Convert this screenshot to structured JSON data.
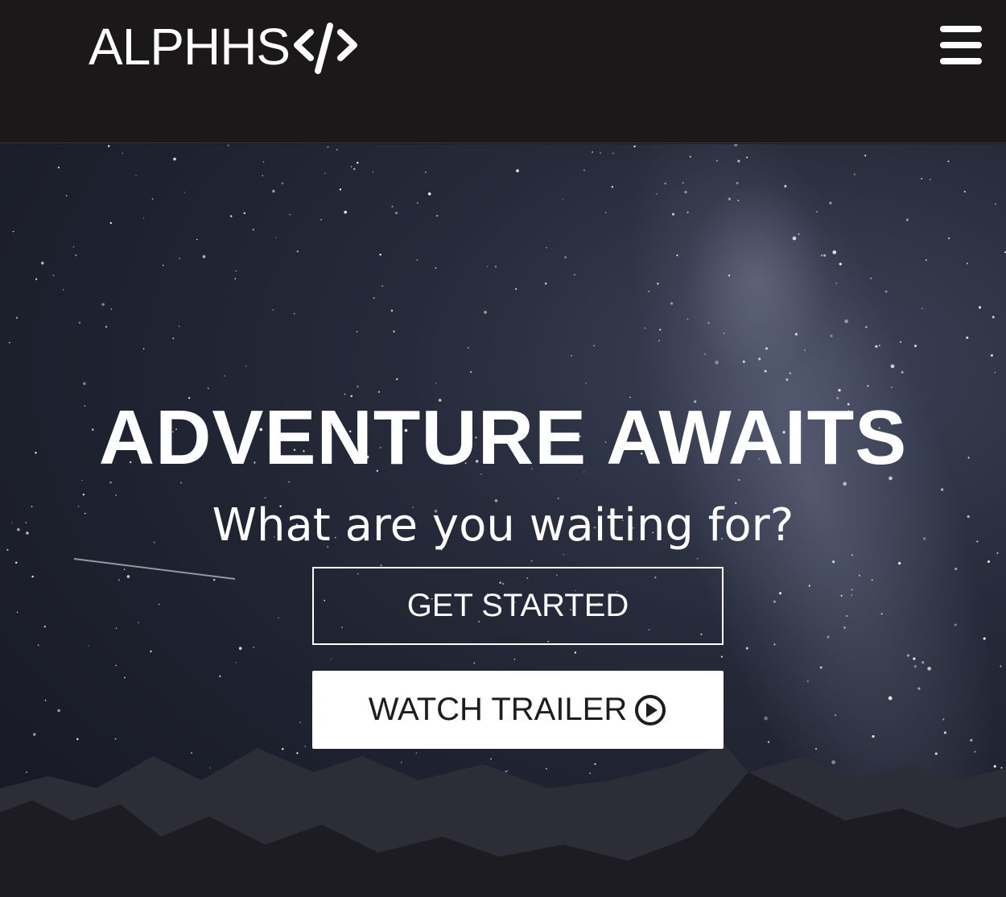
{
  "header": {
    "logo_text": "ALPHHS",
    "logo_icon": "code-brackets-icon",
    "menu_icon": "hamburger-menu-icon"
  },
  "hero": {
    "title": "ADVENTURE AWAITS",
    "subtitle": "What are you waiting for?",
    "primary_button": "GET STARTED",
    "secondary_button": "WATCH TRAILER",
    "secondary_button_icon": "play-circle-icon"
  },
  "colors": {
    "navbar_bg": "#1b1819",
    "text": "#ffffff",
    "night_sky": "#1f2230",
    "button_fill": "#ffffff",
    "button_text": "#1d1d1d"
  }
}
